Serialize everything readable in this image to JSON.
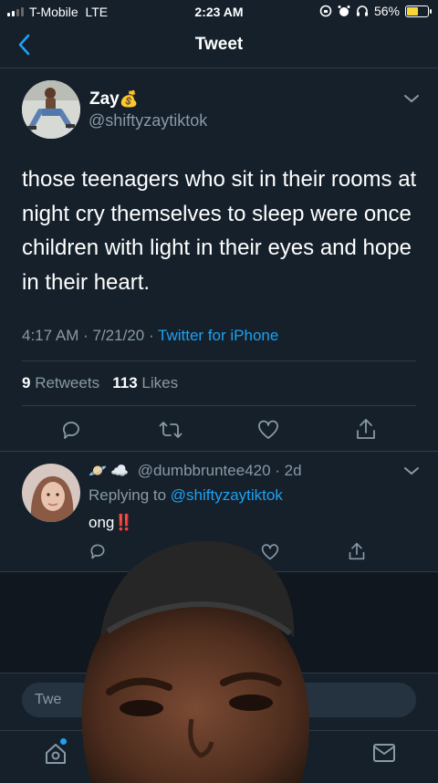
{
  "status_bar": {
    "carrier": "T-Mobile",
    "network": "LTE",
    "time": "2:23 AM",
    "battery": "56%",
    "battery_level": 0.56
  },
  "header": {
    "title": "Tweet"
  },
  "tweet": {
    "author_name": "Zay",
    "author_emoji": "💰",
    "author_handle": "@shiftyzaytiktok",
    "text": "those teenagers who sit in their rooms at night cry themselves to sleep were once children with light in their eyes and hope in their heart.",
    "time": "4:17 AM",
    "date": "7/21/20",
    "source": "Twitter for iPhone",
    "retweets_count": "9",
    "retweets_label": "Retweets",
    "likes_count": "113",
    "likes_label": "Likes"
  },
  "reply": {
    "emojis": "🪐 ☁️",
    "handle": "@dumbbruntee420",
    "age": "2d",
    "replying_to_label": "Replying to",
    "replying_to_handle": "@shiftyzaytiktok",
    "text": "ong",
    "text_emoji": "‼️"
  },
  "compose": {
    "placeholder": "Twe"
  },
  "colors": {
    "background": "#15202b",
    "accent": "#1da1f2",
    "muted": "#8899a6",
    "divider": "#2f3b47"
  }
}
